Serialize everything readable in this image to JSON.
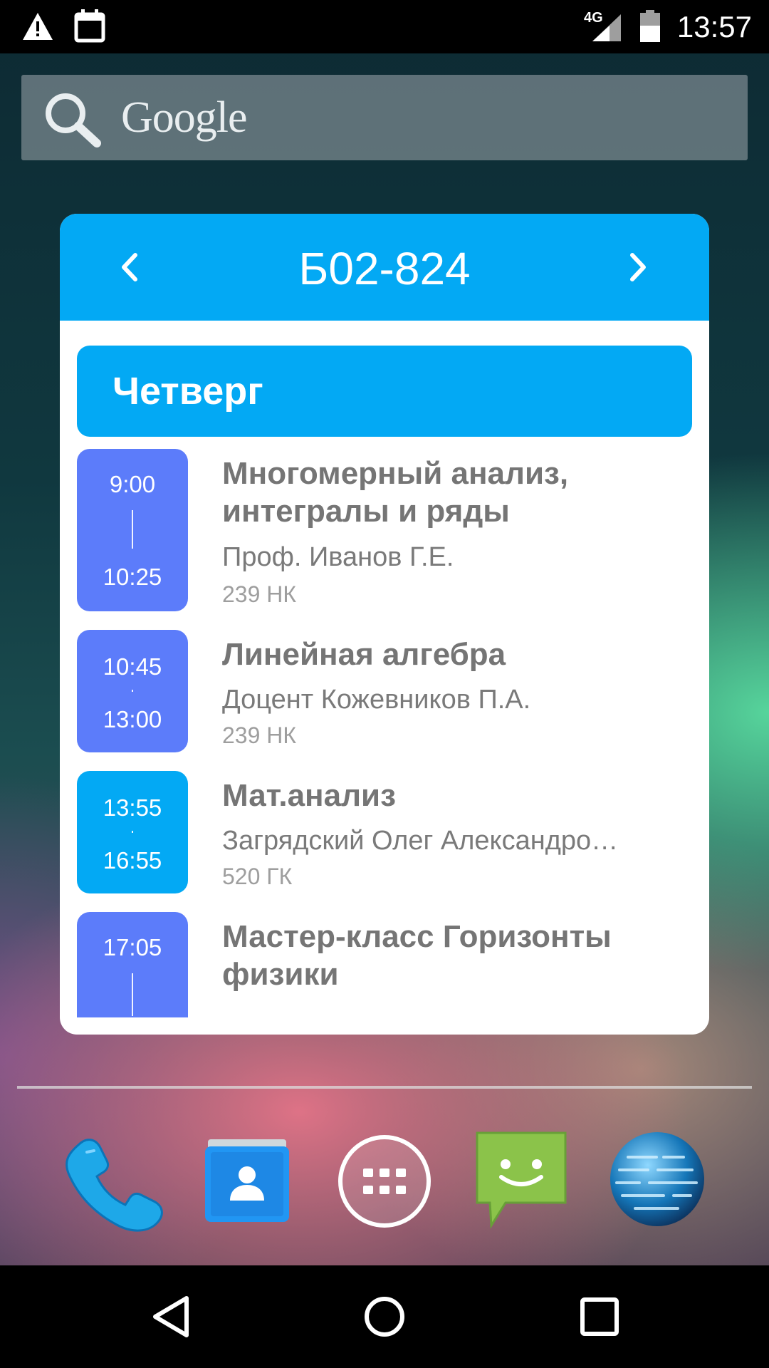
{
  "status_bar": {
    "time": "13:57",
    "network": "4G",
    "icons": [
      "warning-icon",
      "calendar-icon",
      "signal-icon",
      "battery-icon"
    ]
  },
  "search": {
    "logo_text": "Google",
    "icon": "search-icon"
  },
  "widget": {
    "title": "Б02-824",
    "prev_icon": "chevron-left-icon",
    "next_icon": "chevron-right-icon",
    "day": "Четверг",
    "colors": {
      "header": "#03a9f4",
      "lesson_alt": "#5c7cfa",
      "lesson_current": "#03a9f4"
    },
    "lessons": [
      {
        "start": "9:00",
        "end": "10:25",
        "subject_line1": "Многомерный анализ,",
        "subject_line2": "интегралы и ряды",
        "teacher": "Проф. Иванов Г.Е.",
        "room": "239 НК"
      },
      {
        "start": "10:45",
        "end": "13:00",
        "subject_line1": "Линейная алгебра",
        "teacher": "Доцент Кожевников П.А.",
        "room": "239 НК"
      },
      {
        "start": "13:55",
        "end": "16:55",
        "subject_line1": "Мат.анализ",
        "teacher": "Загрядский Олег Александро…",
        "room": "520 ГК"
      },
      {
        "start": "17:05",
        "subject_line1": "Мастер-класс Горизонты",
        "subject_line2": "физики"
      }
    ]
  },
  "dock": {
    "apps": [
      "phone-icon",
      "contacts-icon",
      "app-drawer-icon",
      "messaging-icon",
      "browser-globe-icon"
    ]
  },
  "nav_bar": {
    "buttons": [
      "back-icon",
      "home-icon",
      "recents-icon"
    ]
  }
}
